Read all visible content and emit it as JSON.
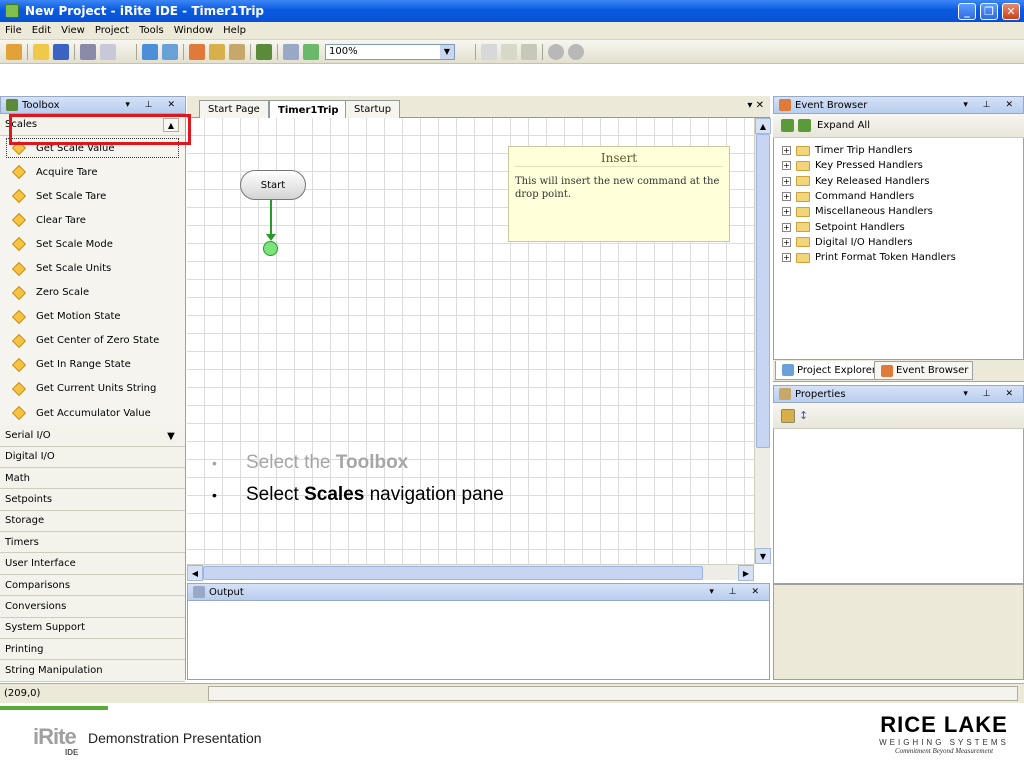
{
  "window": {
    "title": "New Project - iRite IDE - Timer1Trip"
  },
  "menu": [
    "File",
    "Edit",
    "View",
    "Project",
    "Tools",
    "Window",
    "Help"
  ],
  "toolbar": {
    "zoom": "100%"
  },
  "toolbox": {
    "title": "Toolbox",
    "active_category": "Scales",
    "items": [
      "Get Scale Value",
      "Acquire Tare",
      "Set Scale Tare",
      "Clear Tare",
      "Set Scale Mode",
      "Set Scale Units",
      "Zero Scale",
      "Get Motion State",
      "Get Center of Zero State",
      "Get In Range State",
      "Get Current Units String",
      "Get Accumulator Value"
    ],
    "categories": [
      "Serial I/O",
      "Digital I/O",
      "Math",
      "Setpoints",
      "Storage",
      "Timers",
      "User Interface",
      "Comparisons",
      "Conversions",
      "System Support",
      "Printing",
      "String Manipulation"
    ]
  },
  "tabs": [
    "Start Page",
    "Timer1Trip",
    "Startup"
  ],
  "canvas": {
    "start_label": "Start",
    "tooltip_title": "Insert",
    "tooltip_body": "This will insert the new command at the drop point."
  },
  "instructions": [
    {
      "prefix": "Select the ",
      "bold": "Toolbox",
      "suffix": ""
    },
    {
      "prefix": "Select ",
      "bold": "Scales",
      "suffix": " navigation pane"
    }
  ],
  "output": {
    "title": "Output"
  },
  "event_browser": {
    "title": "Event Browser",
    "expand_all": "Expand All",
    "nodes": [
      "Timer Trip Handlers",
      "Key Pressed Handlers",
      "Key Released Handlers",
      "Command Handlers",
      "Miscellaneous Handlers",
      "Setpoint Handlers",
      "Digital I/O Handlers",
      "Print Format Token Handlers"
    ]
  },
  "right_tabs": [
    "Project Explorer",
    "Event Browser"
  ],
  "properties": {
    "title": "Properties"
  },
  "status": {
    "coords": "(209,0)"
  },
  "footer": {
    "caption": "Demonstration Presentation",
    "irite_logo": "iRite",
    "irite_sub": "IDE",
    "brand": "RICE LAKE",
    "brand_sub": "WEIGHING SYSTEMS",
    "brand_tagline": "Commitment Beyond Measurement"
  },
  "colors": {
    "highlight": "#e0161e",
    "titlebar": "#0a5be0",
    "flow": "#2a9a2a"
  }
}
